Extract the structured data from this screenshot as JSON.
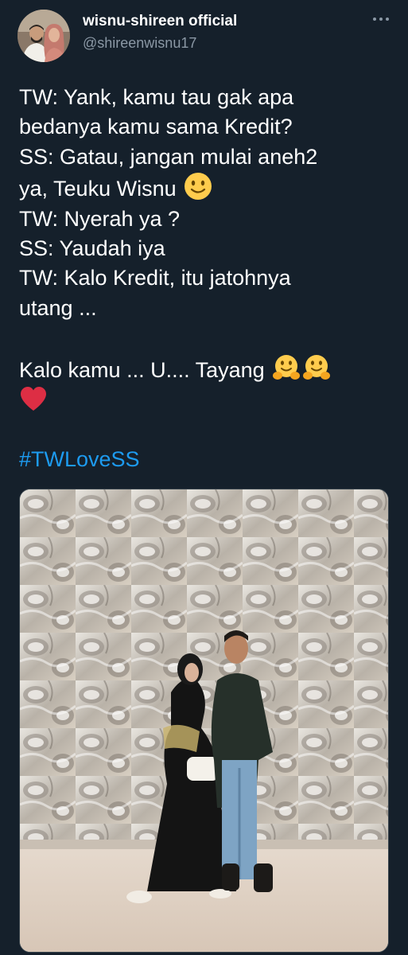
{
  "tweet": {
    "author": {
      "display_name": "wisnu-shireen official",
      "handle": "@shireenwisnu17",
      "avatar_icon": "profile-photo"
    },
    "more_icon": "more-options-icon",
    "lines": [
      "TW: Yank, kamu tau gak apa",
      "bedanya kamu sama Kredit?",
      "SS: Gatau, jangan mulai aneh2",
      "ya, Teuku Wisnu",
      "TW: Nyerah ya ?",
      "SS: Yaudah iya",
      "TW: Kalo Kredit, itu jatohnya",
      "utang ...",
      "Kalo kamu ... U.... Tayang"
    ],
    "emojis": {
      "line4": "slightly-smiling-face",
      "line9": [
        "hugging-face",
        "hugging-face"
      ],
      "after": "red-heart"
    },
    "hashtag": "#TWLoveSS",
    "media": {
      "type": "photo",
      "description_icon": "couple-photo-in-front-of-chrome-sculpture-wall"
    }
  },
  "colors": {
    "background": "#15202b",
    "text": "#ffffff",
    "secondary_text": "#8b98a5",
    "link": "#1d9bf0",
    "heart": "#e0245e",
    "emoji_yellow": "#ffcc4d"
  }
}
